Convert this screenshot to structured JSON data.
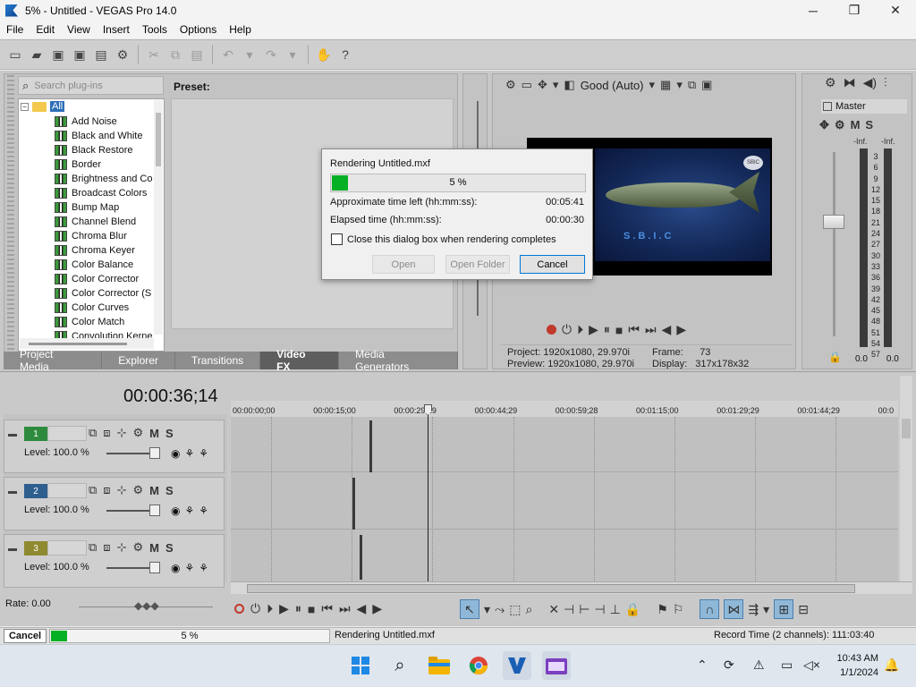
{
  "window": {
    "title": "5% - Untitled - VEGAS Pro 14.0",
    "minimize": "─",
    "maximize": "❐",
    "close": "✕"
  },
  "menu": [
    "File",
    "Edit",
    "View",
    "Insert",
    "Tools",
    "Options",
    "Help"
  ],
  "plugins": {
    "search_placeholder": "Search plug-ins",
    "root": "All",
    "items": [
      "Add Noise",
      "Black and White",
      "Black Restore",
      "Border",
      "Brightness and Co",
      "Broadcast Colors",
      "Bump Map",
      "Channel Blend",
      "Chroma Blur",
      "Chroma Keyer",
      "Color Balance",
      "Color Corrector",
      "Color Corrector (S",
      "Color Curves",
      "Color Match",
      "Convolution Kerne"
    ],
    "preset_label": "Preset:"
  },
  "tabs": [
    "Project Media",
    "Explorer",
    "Transitions",
    "Video FX",
    "Media Generators"
  ],
  "preview": {
    "quality": "Good (Auto)",
    "video_text": "S.B.I.C",
    "logo_text": "SBIC",
    "project_label": "Project:",
    "project_value": "1920x1080, 29.970i",
    "preview_label": "Preview:",
    "preview_value": "1920x1080, 29.970i",
    "frame_label": "Frame:",
    "frame_value": "73",
    "display_label": "Display:",
    "display_value": "317x178x32"
  },
  "master": {
    "label": "Master",
    "mute": "M",
    "solo": "S",
    "inf_left": "-Inf.",
    "inf_right": "-Inf.",
    "ticks": [
      "3",
      "6",
      "9",
      "12",
      "15",
      "18",
      "21",
      "24",
      "27",
      "30",
      "33",
      "36",
      "39",
      "42",
      "45",
      "48",
      "51",
      "54",
      "57"
    ],
    "val_left": "0.0",
    "val_right": "0.0"
  },
  "render_dialog": {
    "title": "Rendering Untitled.mxf",
    "progress_text": "5 %",
    "progress": 0.05,
    "time_left_label": "Approximate time left (hh:mm:ss):",
    "time_left": "00:05:41",
    "elapsed_label": "Elapsed time (hh:mm:ss):",
    "elapsed": "00:00:30",
    "close_checkbox": "Close this dialog box when rendering completes",
    "btn_open": "Open",
    "btn_open_folder": "Open Folder",
    "btn_cancel": "Cancel"
  },
  "timeline": {
    "timecode": "00:00:36;14",
    "ruler": [
      "00:00:00;00",
      "00:00:15;00",
      "00:00:29;29",
      "00:00:44;29",
      "00:00:59;28",
      "00:01:15;00",
      "00:01:29;29",
      "00:01:44;29",
      "00:0"
    ],
    "tracks": [
      {
        "number": "1",
        "level": "Level: 100.0 %",
        "color": "#2e8b3e"
      },
      {
        "number": "2",
        "level": "Level: 100.0 %",
        "color": "#2f5f8f"
      },
      {
        "number": "3",
        "level": "Level: 100.0 %",
        "color": "#8f8a2f"
      }
    ],
    "mute": "M",
    "solo": "S",
    "rate": "Rate: 0.00"
  },
  "statusbar": {
    "cancel": "Cancel",
    "progress_text": "5 %",
    "progress": 0.05,
    "status": "Rendering Untitled.mxf",
    "record_time": "Record Time (2 channels): 111:03:40"
  },
  "taskbar": {
    "time": "10:43 AM",
    "date": "1/1/2024"
  },
  "colors": {
    "progress_green": "#06b025",
    "dialog_accent": "#0078d7"
  }
}
